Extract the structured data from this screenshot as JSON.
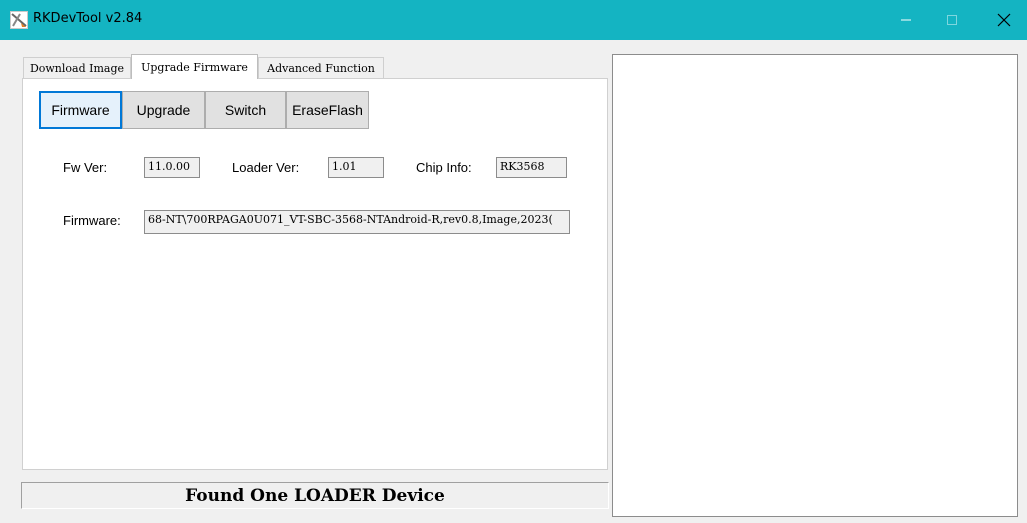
{
  "window": {
    "title": "RKDevTool v2.84",
    "app_icon": "rk-devtool-icon",
    "controls": [
      "minimize-icon",
      "maximize-icon",
      "close-icon"
    ],
    "accent_color": "#14b4c2"
  },
  "tabs": [
    {
      "label": "Download Image",
      "selected": false
    },
    {
      "label": "Upgrade Firmware",
      "selected": true
    },
    {
      "label": "Advanced Function",
      "selected": false
    }
  ],
  "buttons": {
    "firmware": "Firmware",
    "upgrade": "Upgrade",
    "switch": "Switch",
    "erase_flash": "EraseFlash"
  },
  "info": {
    "fw_ver_label": "Fw Ver:",
    "fw_ver_value": "11.0.00",
    "loader_ver_label": "Loader Ver:",
    "loader_ver_value": "1.01",
    "chip_info_label": "Chip Info:",
    "chip_info_value": "RK3568",
    "firmware_label": "Firmware:",
    "firmware_path": "68-NT\\700RPAGA0U071_VT-SBC-3568-NTAndroid-R,rev0.8,Image,2023("
  },
  "status": {
    "text": "Found One LOADER Device"
  }
}
